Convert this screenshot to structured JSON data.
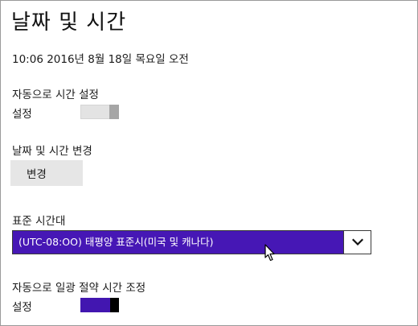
{
  "page": {
    "title": "날짜 및 시간",
    "current_datetime": "10:06 2016년 8월 18일 목요일 오전"
  },
  "auto_time": {
    "label": "자동으로 시간 설정",
    "state_label": "설정",
    "enabled": false
  },
  "change_datetime": {
    "label": "날짜 및 시간 변경",
    "button_label": "변경"
  },
  "timezone": {
    "label": "표준 시간대",
    "selected": "(UTC-08:OO) 태평양 표준시(미국 및 캐나다)",
    "icon": "chevron-down-icon"
  },
  "dst": {
    "label": "자동으로 일광 절약 시간 조정",
    "state_label": "설정",
    "enabled": true
  },
  "colors": {
    "accent": "#4617b5",
    "toggle_off_track": "#e3e3e3",
    "toggle_off_thumb": "#a6a6a6",
    "toggle_on_thumb": "#000000",
    "button_bg": "#e6e6e6"
  }
}
